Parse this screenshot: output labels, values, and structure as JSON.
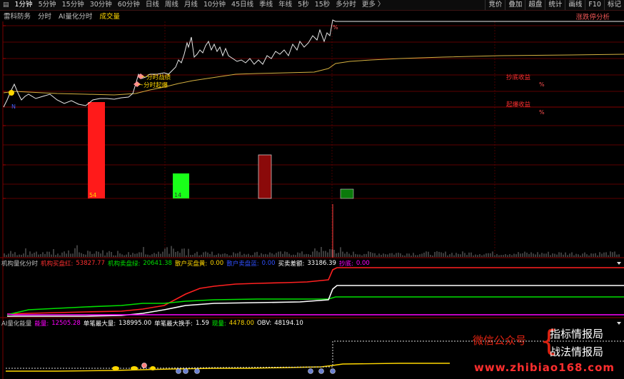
{
  "toolbar": {
    "timeframes": [
      "1分钟",
      "5分钟",
      "15分钟",
      "30分钟",
      "60分钟",
      "日线",
      "周线",
      "月线",
      "10分钟",
      "45日线",
      "季线",
      "年线",
      "5秒",
      "15秒",
      "多分时",
      "更多 〉"
    ],
    "selected_index": 0,
    "tools": [
      "竞价",
      "叠加",
      "超盘",
      "统计",
      "画线",
      "F10",
      "标记"
    ]
  },
  "subbar": {
    "items": [
      "雷科防务",
      "分时",
      "AI量化分时"
    ],
    "volume_label": "成交量",
    "right_label": "涨跌停分析"
  },
  "annotations": {
    "a1": "分时战绩",
    "a2": "分时起爆",
    "box1_title": "抄底收益",
    "box2_title": "起爆收益",
    "marker_n": "N"
  },
  "bars": {
    "b1": "54",
    "b2": "14"
  },
  "info1": {
    "name": "机构量化分时",
    "k1": "机构买盘红:",
    "v1": "53827.77",
    "k2": "机构卖盘绿:",
    "v2": "20641.38",
    "k3": "散户买盘黄:",
    "v3": "0.00",
    "k4": "散户卖盘蓝:",
    "v4": "0.00",
    "k5": "买卖差额:",
    "v5": "33186.39",
    "k6": "抄底:",
    "v6": "0.00"
  },
  "info2": {
    "name": "AI量化能量",
    "k1": "能量:",
    "v1": "12505.28",
    "k2": "单笔最大量:",
    "v2": "138995.00",
    "k3": "单笔最大换手:",
    "v3": "1.59",
    "k4": "现量:",
    "v4": "4478.00",
    "k5": "OBV:",
    "v5": "48194.10"
  },
  "watermark": {
    "wechat": "微信公众号",
    "line1": "指标情报局",
    "line2": "战法情报局",
    "site": "www.zhibiao168.com"
  },
  "colors": {
    "red": "#ff2020",
    "green": "#00ff00",
    "yellow": "#ffd700",
    "white": "#ffffff",
    "magenta": "#ff00ff",
    "grid": "#7a0000"
  }
}
